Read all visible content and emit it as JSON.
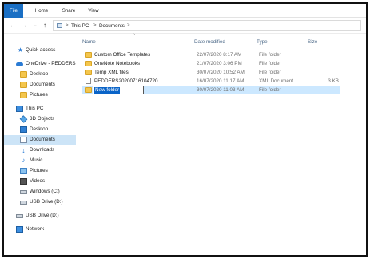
{
  "ribbon": {
    "tabs": [
      "File",
      "Home",
      "Share",
      "View"
    ]
  },
  "address": {
    "segments": [
      "This PC",
      "Documents"
    ],
    "separator": ">"
  },
  "nav": {
    "items": [
      {
        "label": "Quick access",
        "icon": "star-icon"
      },
      {
        "label": "OneDrive - PEDDERS",
        "icon": "cloud-icon"
      },
      {
        "label": "Desktop",
        "icon": "folder-icon"
      },
      {
        "label": "Documents",
        "icon": "folder-icon"
      },
      {
        "label": "Pictures",
        "icon": "folder-icon"
      },
      {
        "label": "This PC",
        "icon": "computer-icon"
      },
      {
        "label": "3D Objects",
        "icon": "cube-icon"
      },
      {
        "label": "Desktop",
        "icon": "desktop-icon"
      },
      {
        "label": "Documents",
        "icon": "document-icon"
      },
      {
        "label": "Downloads",
        "icon": "download-icon"
      },
      {
        "label": "Music",
        "icon": "music-icon"
      },
      {
        "label": "Pictures",
        "icon": "picture-icon"
      },
      {
        "label": "Videos",
        "icon": "video-icon"
      },
      {
        "label": "Windows (C:)",
        "icon": "drive-icon"
      },
      {
        "label": "USB Drive (D:)",
        "icon": "drive-icon"
      },
      {
        "label": "USB Drive (D:)",
        "icon": "drive-icon"
      },
      {
        "label": "Network",
        "icon": "network-icon"
      }
    ],
    "selected_index": 8
  },
  "columns": {
    "name": "Name",
    "date": "Date modified",
    "type": "Type",
    "size": "Size"
  },
  "files": [
    {
      "name": "Custom Office Templates",
      "date": "22/07/2020 8:17 AM",
      "type": "File folder",
      "size": "",
      "icon": "folder-icon"
    },
    {
      "name": "OneNote Notebooks",
      "date": "21/07/2020 3:06 PM",
      "type": "File folder",
      "size": "",
      "icon": "folder-icon"
    },
    {
      "name": "Temp XML files",
      "date": "30/07/2020 10:52 AM",
      "type": "File folder",
      "size": "",
      "icon": "folder-icon"
    },
    {
      "name": "PEDDERS20200716104720",
      "date": "16/07/2020 11:17 AM",
      "type": "XML Document",
      "size": "3 KB",
      "icon": "xml-file-icon"
    },
    {
      "name": "New folder",
      "date": "30/07/2020 11:03 AM",
      "type": "File folder",
      "size": "",
      "icon": "folder-icon",
      "renaming": true
    }
  ],
  "colors": {
    "accent": "#1a6fc4",
    "selection": "#cce8ff",
    "folder": "#f4c64d"
  }
}
